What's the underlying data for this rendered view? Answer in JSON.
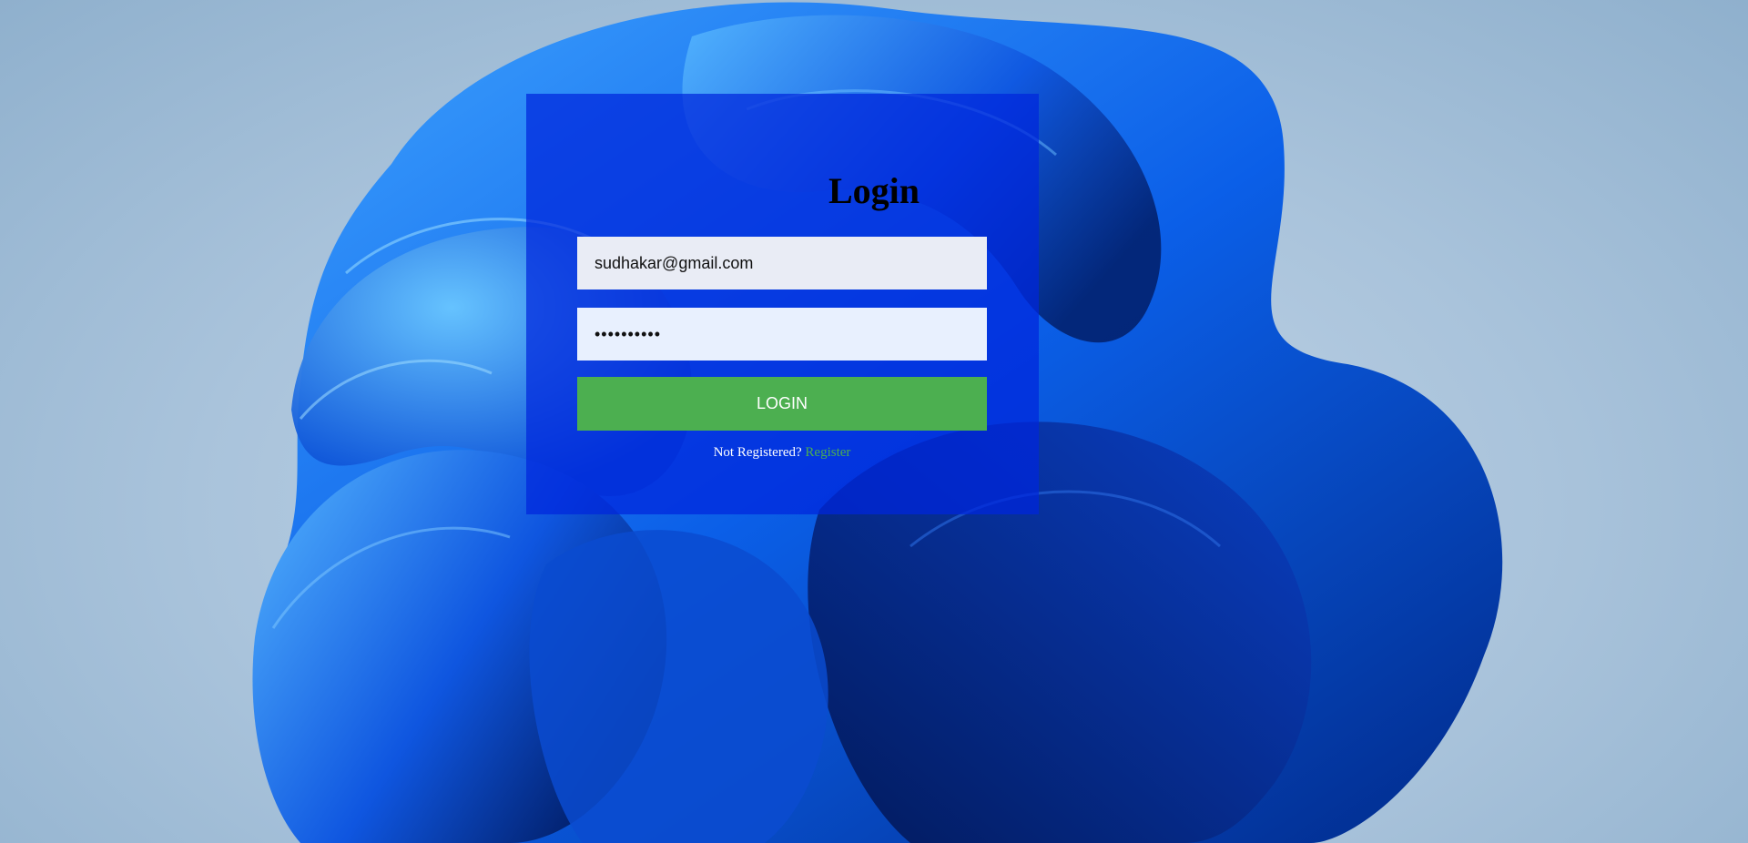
{
  "page": {
    "background_color": "#a9c3db",
    "wallpaper": "blue-bloom-abstract"
  },
  "login_form": {
    "title": "Login",
    "email_value": "sudhakar@gmail.com",
    "password_value": "••••••••••",
    "submit_label": "LOGIN",
    "register_prompt": "Not Registered?",
    "register_link": "Register",
    "accent_color": "#4caf50",
    "card_color": "#0026dc"
  }
}
